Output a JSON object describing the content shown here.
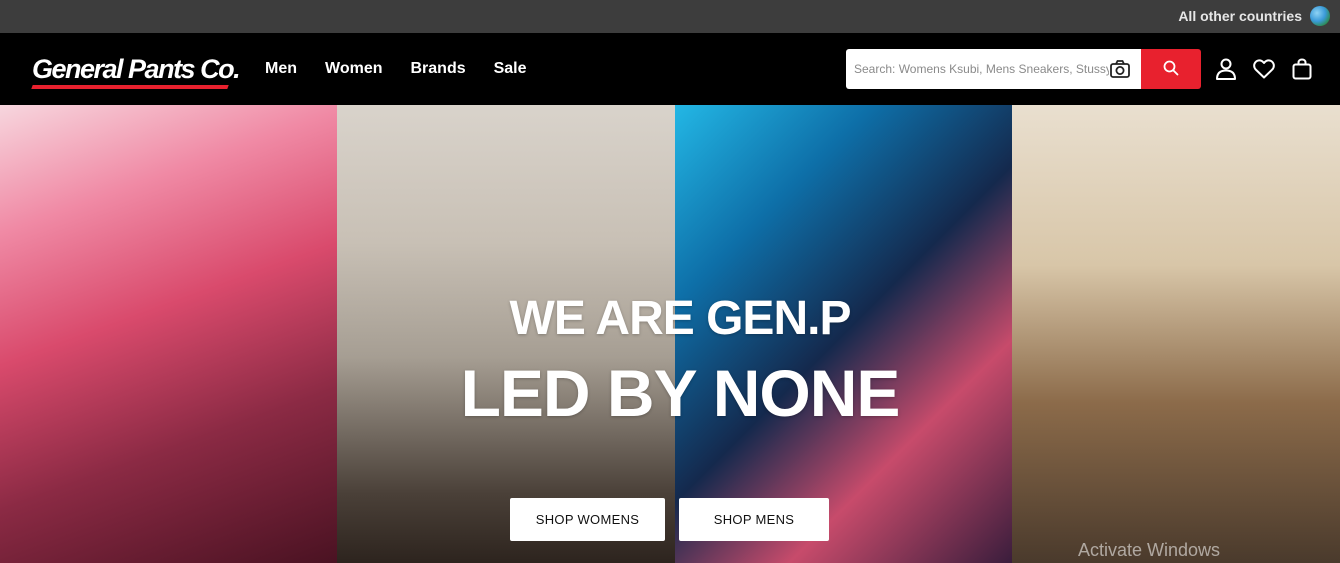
{
  "topbar": {
    "country_label": "All other countries",
    "globe_icon": "globe-icon"
  },
  "header": {
    "logo_text": "General Pants Co.",
    "nav": [
      {
        "label": "Men"
      },
      {
        "label": "Women"
      },
      {
        "label": "Brands"
      },
      {
        "label": "Sale"
      }
    ],
    "search": {
      "placeholder": "Search: Womens Ksubi, Mens Sneakers, Stussy",
      "value": "",
      "camera_icon": "camera-icon",
      "submit_icon": "search-icon"
    },
    "icons": [
      "account-icon",
      "heart-icon",
      "bag-icon"
    ]
  },
  "hero": {
    "line1": "WE ARE GEN.P",
    "line2": "LED BY NONE",
    "cta_women": "SHOP WOMENS",
    "cta_men": "SHOP MENS"
  },
  "watermark": "Activate Windows",
  "colors": {
    "topbar_bg": "#3d3d3d",
    "header_bg": "#000000",
    "accent_red": "#e8212e",
    "button_bg": "#ffffff"
  }
}
